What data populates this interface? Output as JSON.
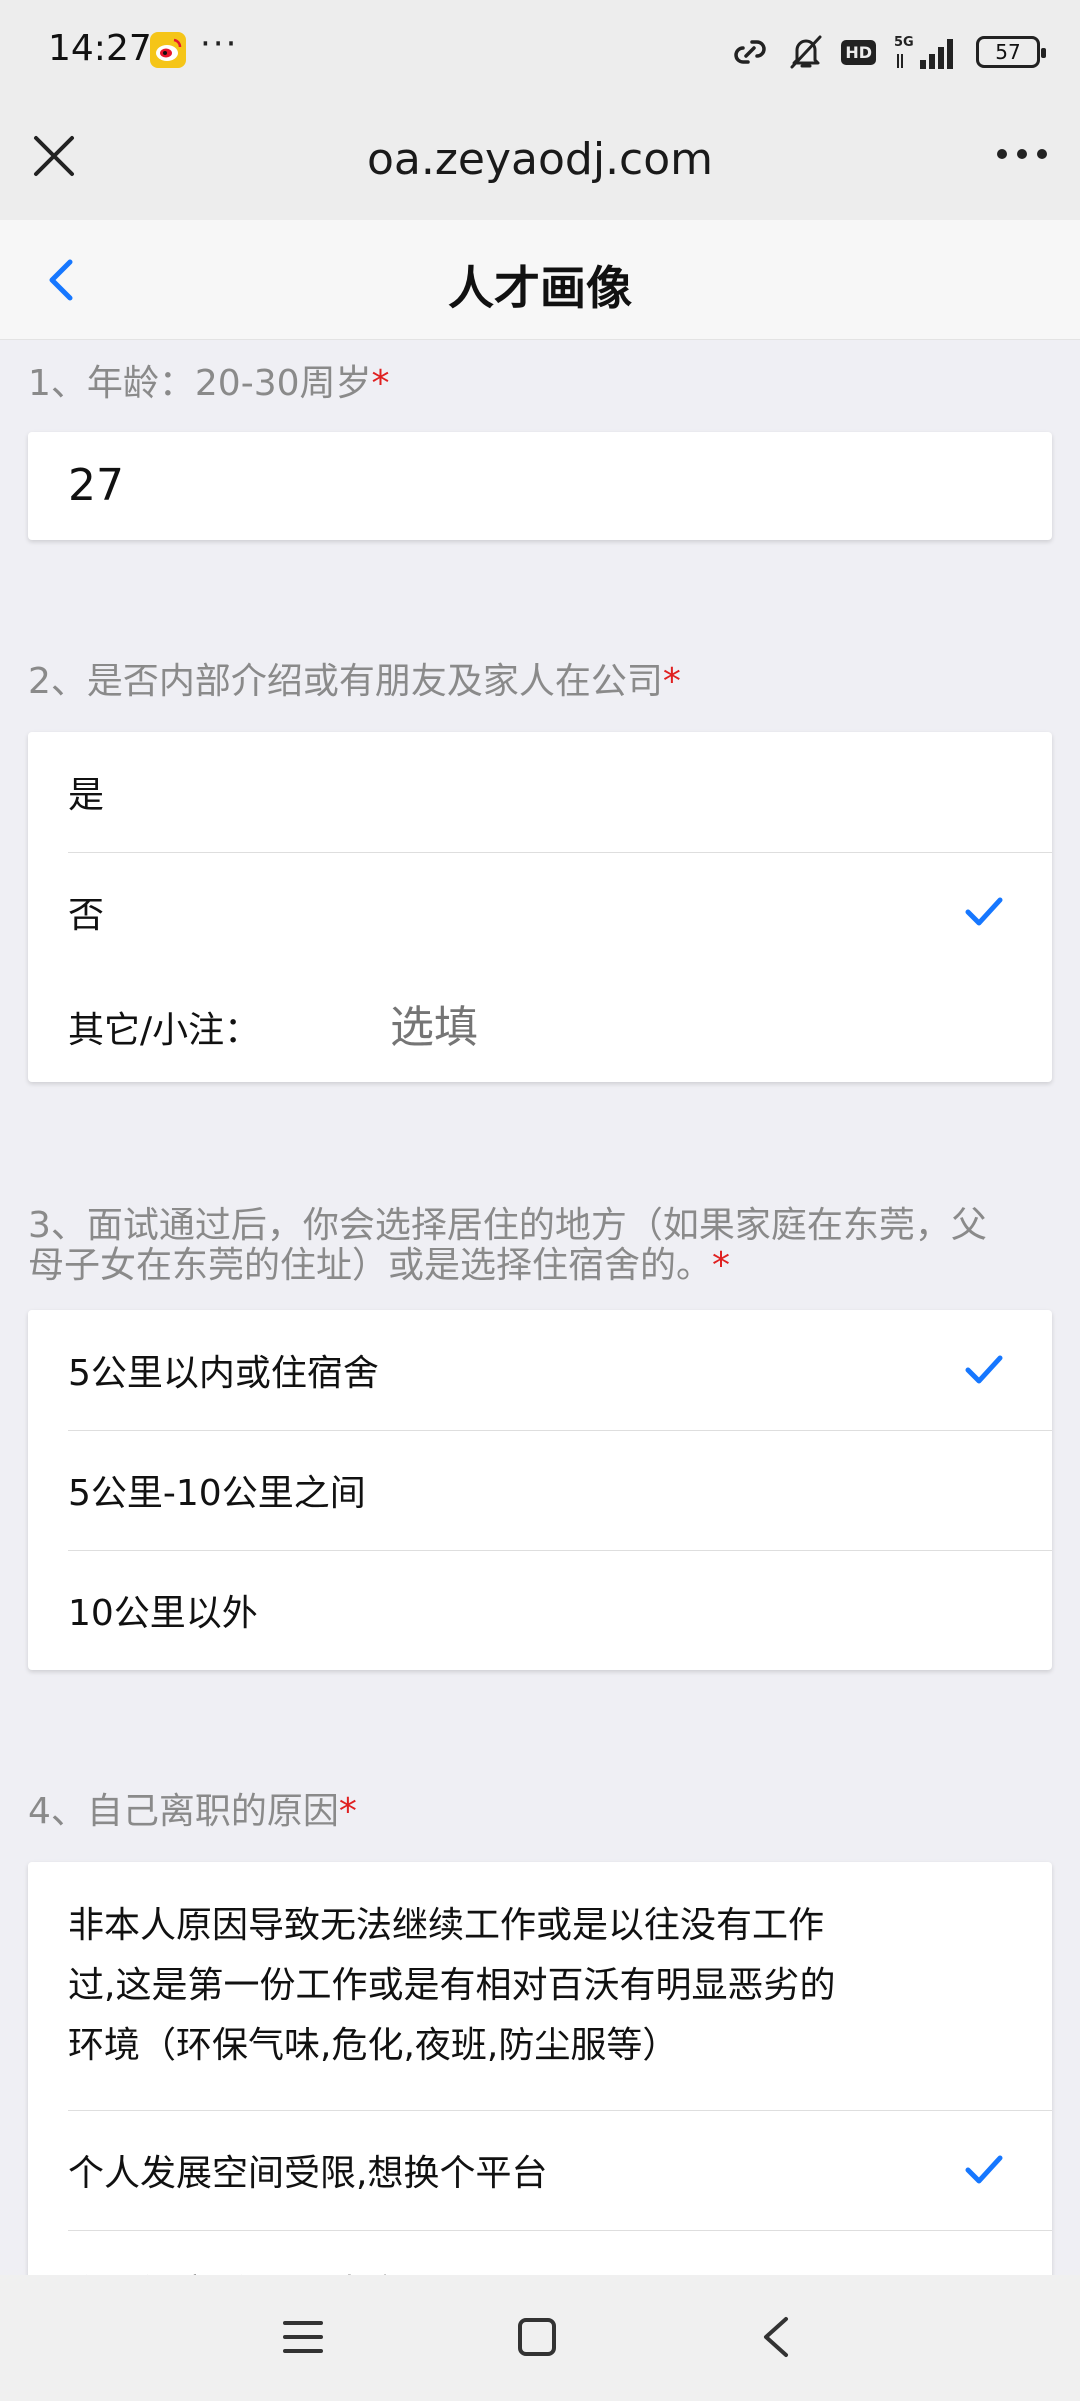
{
  "status_bar": {
    "time": "14:27",
    "dots": "···",
    "network": "5G",
    "hd": "HD",
    "battery": "57"
  },
  "browser": {
    "url": "oa.zeyaodj.com"
  },
  "header": {
    "title": "人才画像"
  },
  "questions": [
    {
      "label": "1、年龄：20-30周岁",
      "required": "*",
      "value": "27"
    },
    {
      "label": "2、是否内部介绍或有朋友及家人在公司",
      "required": "*",
      "options": [
        "是",
        "否"
      ],
      "selected": "否",
      "other_label": "其它/小注：",
      "other_placeholder": "选填"
    },
    {
      "label_line1": "3、面试通过后，你会选择居住的地方（如果家庭在东莞，父",
      "label_line2": "母子女在东莞的住址）或是选择住宿舍的。",
      "required": "*",
      "options": [
        "5公里以内或住宿舍",
        "5公里-10公里之间",
        "10公里以外"
      ],
      "selected": "5公里以内或住宿舍"
    },
    {
      "label": "4、自己离职的原因",
      "required": "*",
      "option1_lines": [
        "非本人原因导致无法继续工作或是以往没有工作",
        "过,这是第一份工作或是有相对百沃有明显恶劣的",
        "环境（环保气味,危化,夜班,防尘服等）"
      ],
      "options": [
        "个人发展空间受限,想换个平台",
        "个人健康,个人私事离职"
      ],
      "selected": "个人发展空间受限,想换个平台"
    }
  ],
  "colors": {
    "accent": "#1677ff",
    "required": "#e02020",
    "label_gray": "#8a8a8a"
  }
}
